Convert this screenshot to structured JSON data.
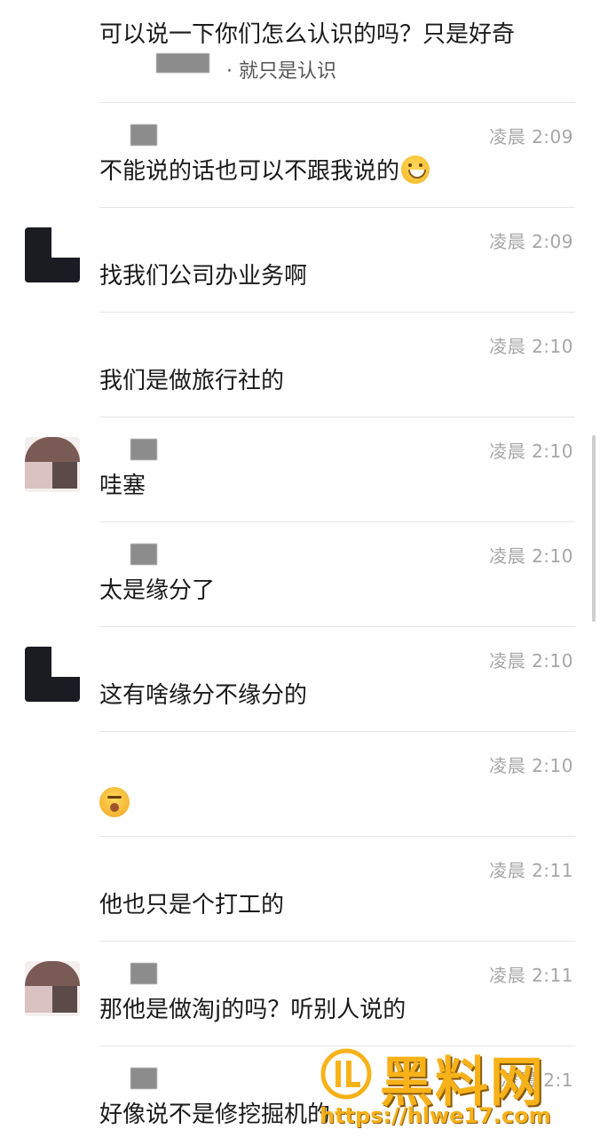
{
  "top_message": {
    "text": "可以说一下你们怎么认识的吗？只是好奇",
    "sub_text": "· 就只是认识"
  },
  "messages": [
    {
      "time": "凌晨 2:09",
      "text": "不能说的话也可以不跟我说的",
      "avatar": "none",
      "emoji": "grinning-face"
    },
    {
      "time": "凌晨 2:09",
      "text": "找我们公司办业务啊",
      "avatar": "dark"
    },
    {
      "time": "凌晨 2:10",
      "text": "我们是做旅行社的",
      "avatar": "none"
    },
    {
      "time": "凌晨 2:10",
      "text": "哇塞",
      "avatar": "brown"
    },
    {
      "time": "凌晨 2:10",
      "text": "太是缘分了",
      "avatar": "none"
    },
    {
      "time": "凌晨 2:10",
      "text": "这有啥缘分不缘分的",
      "avatar": "dark"
    },
    {
      "time": "凌晨 2:10",
      "text": "",
      "avatar": "none",
      "emoji": "zipper-mouth-face"
    },
    {
      "time": "凌晨 2:11",
      "text": "他也只是个打工的",
      "avatar": "none"
    },
    {
      "time": "凌晨 2:11",
      "text": "那他是做淘j的吗？听别人说的",
      "avatar": "brown"
    },
    {
      "time": "凌晨 2:1",
      "text": "好像说不是修挖掘机的",
      "avatar": "none"
    }
  ],
  "watermark": {
    "title": "黑料网",
    "url": "https://hlwe17.com",
    "color": "#f7b21a"
  },
  "colors": {
    "text": "#1a1a1a",
    "time": "#a6a6a6",
    "divider": "#e6e6e6"
  }
}
